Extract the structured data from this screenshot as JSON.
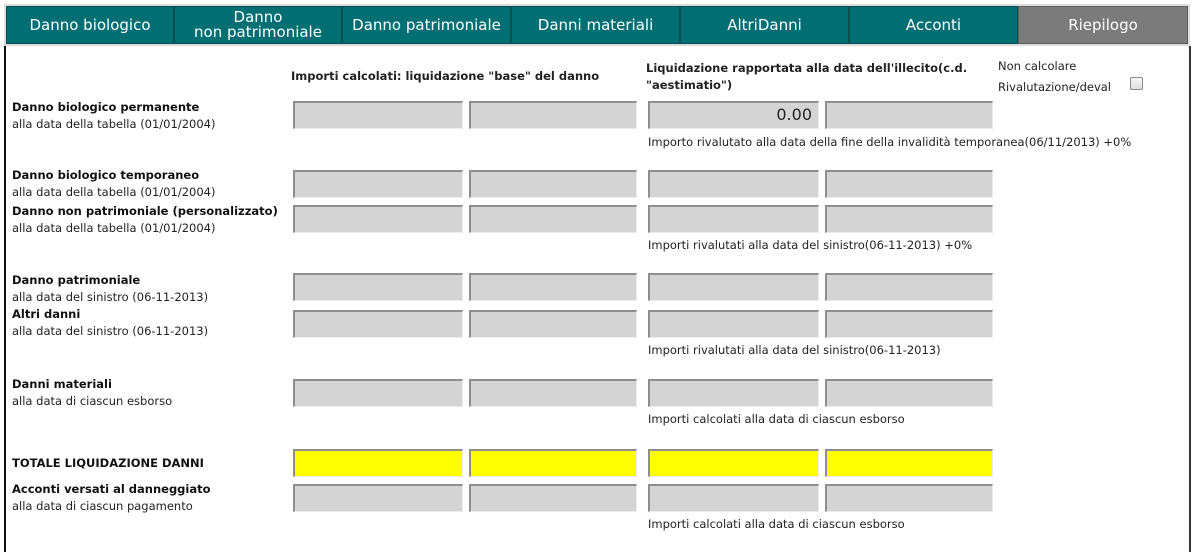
{
  "tabs": [
    {
      "label": "Danno biologico"
    },
    {
      "label_line1": "Danno",
      "label_line2": "non patrimoniale"
    },
    {
      "label": "Danno patrimoniale"
    },
    {
      "label": "Danni materiali"
    },
    {
      "label": "AltriDanni"
    },
    {
      "label": "Acconti"
    },
    {
      "label": "Riepilogo",
      "active": true
    }
  ],
  "headers": {
    "col_base": "Importi calcolati: liquidazione \"base\" del danno",
    "col_aest_line1": "Liquidazione rapportata alla data dell'illecito(c.d.",
    "col_aest_line2": "\"aestimatio\")",
    "non_calcolare": "Non calcolare",
    "rivalutazione": "Rivalutazione/deval"
  },
  "rows": {
    "biologico_permanente": {
      "title": "Danno biologico permanente",
      "sub": "alla data della tabella (01/01/2004)",
      "value_c3": "0.00"
    },
    "biologico_temporaneo": {
      "title": "Danno biologico temporaneo",
      "sub": "alla data della tabella (01/01/2004)"
    },
    "non_patrimoniale": {
      "title": "Danno non patrimoniale (personalizzato)",
      "sub": "alla data della tabella (01/01/2004)"
    },
    "patrimoniale": {
      "title": "Danno patrimoniale",
      "sub": "alla data del sinistro (06-11-2013)"
    },
    "altri_danni": {
      "title": "Altri danni",
      "sub": "alla data del sinistro (06-11-2013)"
    },
    "danni_materiali": {
      "title": "Danni materiali",
      "sub": "alla data di ciascun esborso"
    },
    "totale": {
      "title": "TOTALE LIQUIDAZIONE DANNI"
    },
    "acconti": {
      "title": "Acconti versati al danneggiato",
      "sub": "alla data di ciascun pagamento"
    }
  },
  "notes": {
    "n1": "Importo rivalutato alla data della fine della invalidità temporanea(06/11/2013) +0%",
    "n2": "Importi rivalutati alla data del sinistro(06-11-2013) +0%",
    "n3": "Importi rivalutati alla data del sinistro(06-11-2013)",
    "n4": "Importi calcolati alla data di ciascun esborso",
    "n5": "Importi calcolati alla data di ciascun esborso"
  },
  "colors": {
    "tab": "#006f73",
    "tab_active": "#7b7b7b",
    "total_highlight": "#ffff00"
  }
}
